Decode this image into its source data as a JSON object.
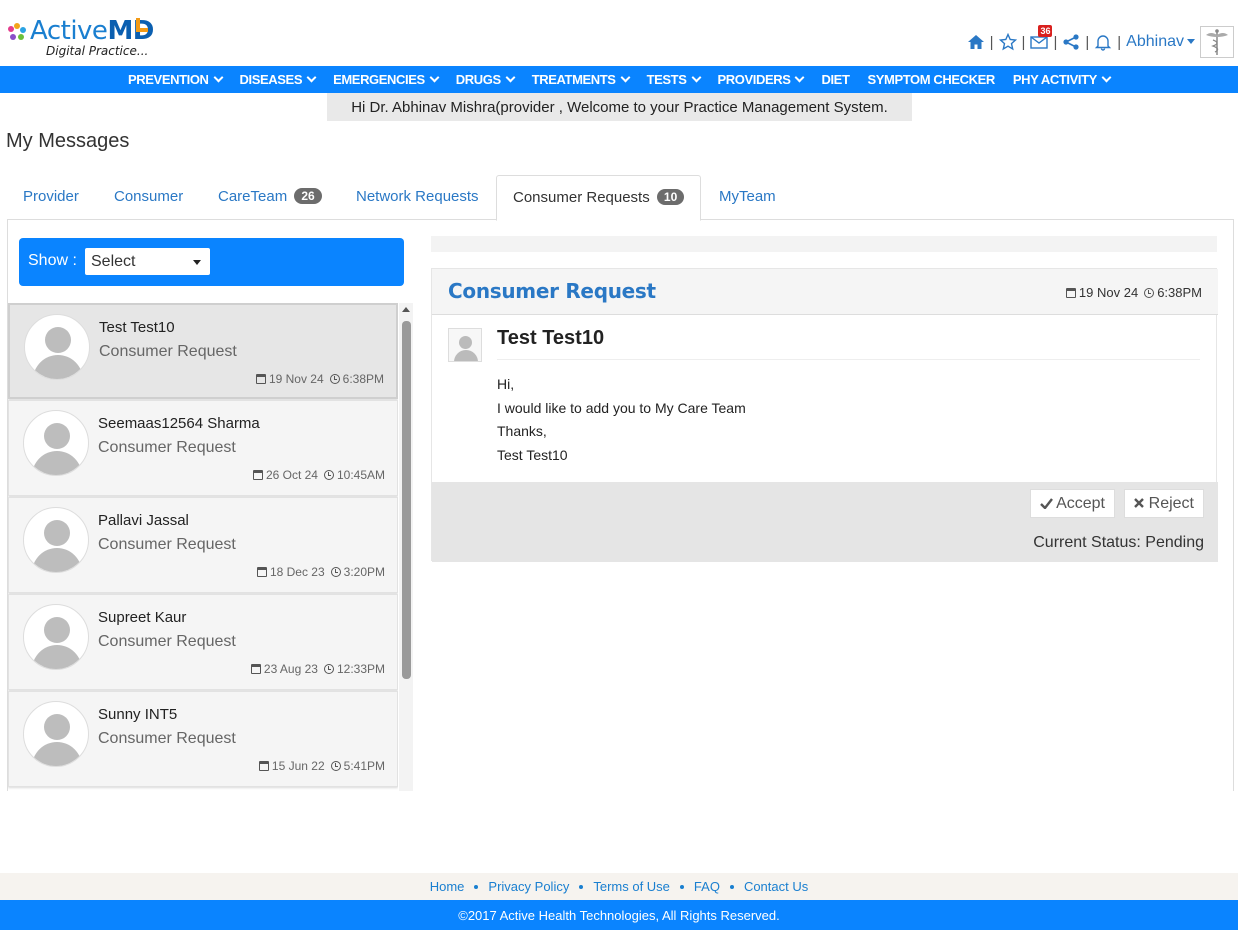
{
  "brand": {
    "name_part1": "Active",
    "name_part2": "MD",
    "tagline": "Digital Practice..."
  },
  "header": {
    "mail_count": "36",
    "user_name": "Abhinav",
    "icons": [
      "home-icon",
      "star-icon",
      "mail-icon",
      "share-icon",
      "bell-icon",
      "caduceus-icon"
    ]
  },
  "nav": {
    "items": [
      {
        "label": "PREVENTION",
        "dropdown": true
      },
      {
        "label": "DISEASES",
        "dropdown": true
      },
      {
        "label": "EMERGENCIES",
        "dropdown": true
      },
      {
        "label": "DRUGS",
        "dropdown": true
      },
      {
        "label": "TREATMENTS",
        "dropdown": true
      },
      {
        "label": "TESTS",
        "dropdown": true
      },
      {
        "label": "PROVIDERS",
        "dropdown": true
      },
      {
        "label": "DIET",
        "dropdown": false
      },
      {
        "label": "SYMPTOM CHECKER",
        "dropdown": false
      },
      {
        "label": "PHY ACTIVITY",
        "dropdown": true
      }
    ]
  },
  "welcome": "Hi Dr. Abhinav Mishra(provider , Welcome to your Practice Management System.",
  "page_title": "My Messages",
  "tabs": [
    {
      "label": "Provider",
      "badge": ""
    },
    {
      "label": "Consumer",
      "badge": ""
    },
    {
      "label": "CareTeam",
      "badge": "26"
    },
    {
      "label": "Network Requests",
      "badge": ""
    },
    {
      "label": "Consumer Requests",
      "badge": "10",
      "active": true
    },
    {
      "label": "MyTeam",
      "badge": ""
    }
  ],
  "filter": {
    "label": "Show :",
    "value": "Select"
  },
  "messages": [
    {
      "name": "Test Test10",
      "type": "Consumer Request",
      "date": "19 Nov 24",
      "time": "6:38PM",
      "selected": true
    },
    {
      "name": "Seemaas12564 Sharma",
      "type": "Consumer Request",
      "date": "26 Oct 24",
      "time": "10:45AM"
    },
    {
      "name": "Pallavi Jassal",
      "type": "Consumer Request",
      "date": "18 Dec 23",
      "time": "3:20PM"
    },
    {
      "name": "Supreet Kaur",
      "type": "Consumer Request",
      "date": "23 Aug 23",
      "time": "12:33PM"
    },
    {
      "name": "Sunny INT5",
      "type": "Consumer Request",
      "date": "15 Jun 22",
      "time": "5:41PM"
    }
  ],
  "detail": {
    "title": "Consumer Request",
    "date": "19 Nov 24",
    "time": "6:38PM",
    "sender": "Test Test10",
    "body": [
      "Hi,",
      "I would like to add you to My Care Team",
      "Thanks,",
      "Test Test10"
    ],
    "accept_label": "Accept",
    "reject_label": "Reject",
    "status": "Current Status: Pending"
  },
  "footer": {
    "links": [
      "Home",
      "Privacy Policy",
      "Terms of Use",
      "FAQ",
      "Contact Us"
    ],
    "copyright": "©2017 Active Health Technologies, All Rights Reserved."
  },
  "colors": {
    "primary": "#0a84ff",
    "link": "#2a78c5",
    "badge": "#6c6c6c",
    "mail_badge": "#d9201e",
    "logo_accent": "#f29a16"
  }
}
